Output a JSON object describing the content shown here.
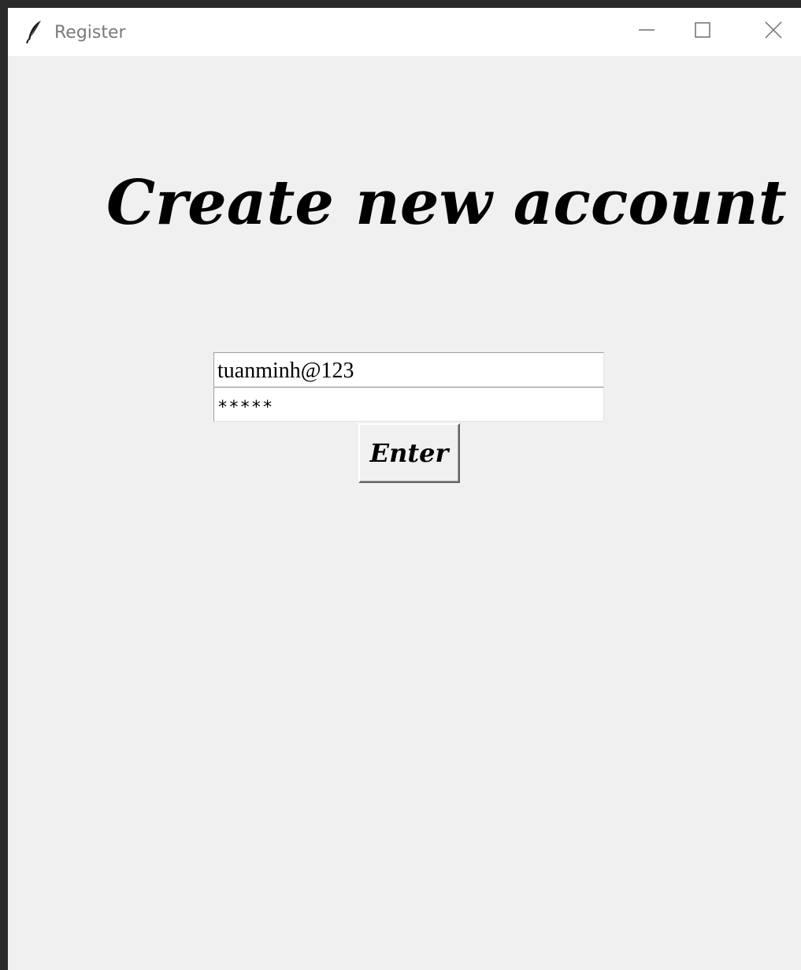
{
  "window": {
    "title": "Register",
    "icon": "feather-icon",
    "controls": {
      "minimize": "minimize-icon",
      "maximize": "maximize-icon",
      "close": "close-icon"
    }
  },
  "form": {
    "heading": "Create new account",
    "username_value": "tuanminh@123",
    "password_value": "*****",
    "submit_label": "Enter"
  },
  "colors": {
    "background": "#f0f0f0",
    "titlebar": "#ffffff",
    "title_text": "#7a7a7a",
    "text": "#000000"
  }
}
